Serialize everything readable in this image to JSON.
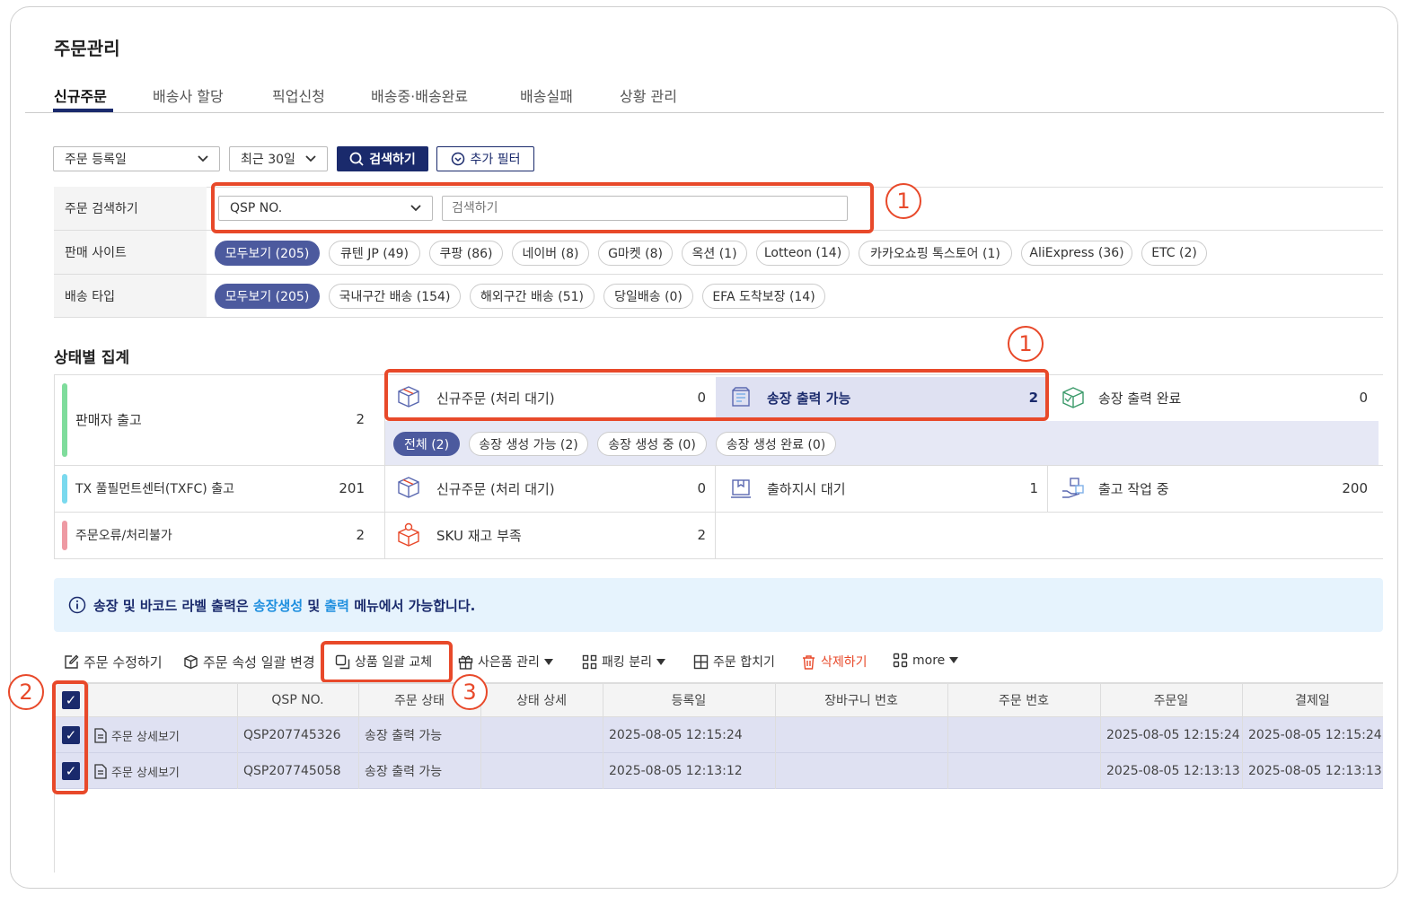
{
  "page": {
    "title": "주문관리"
  },
  "tabs": [
    {
      "label": "신규주문"
    },
    {
      "label": "배송사 할당"
    },
    {
      "label": "픽업신청"
    },
    {
      "label": "배송중·배송완료"
    },
    {
      "label": "배송실패"
    },
    {
      "label": "상황 관리"
    }
  ],
  "filters": {
    "date_type": "주문 등록일",
    "period": "최근 30일",
    "search_button": "검색하기",
    "add_filter_button": "추가 필터"
  },
  "search": {
    "label": "주문 검색하기",
    "field_type": "QSP NO.",
    "placeholder": "검색하기"
  },
  "sales_site": {
    "label": "판매 사이트",
    "chips": [
      "모두보기 (205)",
      "큐텐 JP (49)",
      "쿠팡 (86)",
      "네이버 (8)",
      "G마켓 (8)",
      "옥션 (1)",
      "Lotteon (14)",
      "카카오쇼핑 톡스토어 (1)",
      "AliExpress (36)",
      "ETC (2)"
    ]
  },
  "delivery_type": {
    "label": "배송 타입",
    "chips": [
      "모두보기 (205)",
      "국내구간 배송 (154)",
      "해외구간 배송 (51)",
      "당일배송 (0)",
      "EFA 도착보장 (14)"
    ]
  },
  "annotations": {
    "one": "1",
    "two": "2",
    "three": "3"
  },
  "status_summary": {
    "title": "상태별 집계",
    "groups": [
      {
        "label": "판매자 출고",
        "count": "2",
        "color": "#7fdc9c"
      },
      {
        "label": "TX 풀필먼트센터(TXFC) 출고",
        "count": "201",
        "color": "#7ad9ee"
      },
      {
        "label": "주문오류/처리불가",
        "count": "2",
        "color": "#ee9aa3"
      }
    ],
    "seller_items": [
      {
        "label": "신규주문 (처리 대기)",
        "count": "0"
      },
      {
        "label": "송장 출력 가능",
        "count": "2"
      },
      {
        "label": "송장 출력 완료",
        "count": "0"
      }
    ],
    "sub_chips": [
      "전체 (2)",
      "송장 생성 가능 (2)",
      "송장 생성 중 (0)",
      "송장 생성 완료 (0)"
    ],
    "txfc_items": [
      {
        "label": "신규주문 (처리 대기)",
        "count": "0"
      },
      {
        "label": "출하지시 대기",
        "count": "1"
      },
      {
        "label": "출고 작업 중",
        "count": "200"
      }
    ],
    "error_items": [
      {
        "label": "SKU 재고 부족",
        "count": "2"
      }
    ]
  },
  "info_banner": {
    "text_before": "송장 및 바코드 라벨 출력은 ",
    "link1": "송장생성",
    "text_mid": " 및 ",
    "link2": "출력",
    "text_after": " 메뉴에서 가능합니다."
  },
  "toolbar": {
    "edit": "주문 수정하기",
    "bulk_attr": "주문 속성 일괄 변경",
    "bulk_replace": "상품 일괄 교체",
    "gift": "사은품 관리",
    "split": "패킹 분리",
    "merge": "주문 합치기",
    "delete": "삭제하기",
    "more": "more",
    "delete_color": "#e8492a"
  },
  "table": {
    "headers": [
      "QSP NO.",
      "주문 상태",
      "상태 상세",
      "등록일",
      "장바구니 번호",
      "주문 번호",
      "주문일",
      "결제일"
    ],
    "rows": [
      {
        "detail": "주문 상세보기",
        "qsp": "QSP207745326",
        "status": "송장 출력 가능",
        "status_detail": "",
        "registered": "2025-08-05 12:15:24",
        "cart": "",
        "order_no": "",
        "order_date": "2025-08-05 12:15:24",
        "paid": "2025-08-05 12:15:24"
      },
      {
        "detail": "주문 상세보기",
        "qsp": "QSP207745058",
        "status": "송장 출력 가능",
        "status_detail": "",
        "registered": "2025-08-05 12:13:12",
        "cart": "",
        "order_no": "",
        "order_date": "2025-08-05 12:13:13",
        "paid": "2025-08-05 12:13:13"
      }
    ]
  },
  "colors": {
    "primary": "#1a2a6c",
    "chip_active": "#4c5a9e",
    "highlight": "#e8492a",
    "selected_row": "#dfe1f2",
    "info_bg": "#e6f3fd",
    "link": "#1e8fdf"
  }
}
